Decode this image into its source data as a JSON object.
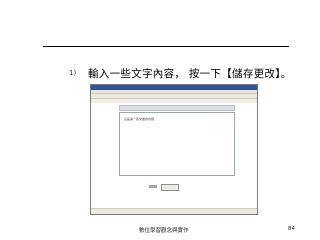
{
  "slide": {
    "bullet_number": "1)",
    "bullet_text": "輸入一些文字內容， 按一下【儲存更改】。",
    "embedded_screenshot": {
      "editor_text": "這是第一篇文章的內容",
      "save_button_label": ""
    },
    "footer": {
      "center_text": "數位學習觀念與實作",
      "page_number": "84"
    }
  }
}
